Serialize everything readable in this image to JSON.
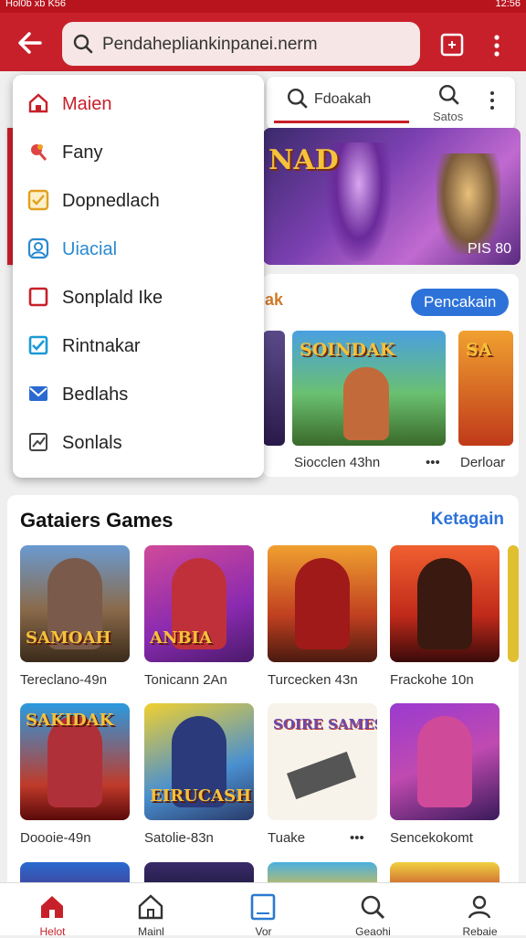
{
  "status_bar": {
    "left": "Hol0b xb K56",
    "right": "12:56"
  },
  "search": {
    "query": "Pendahepliankinpanei.nerm"
  },
  "menu": {
    "items": [
      {
        "label": "Maien",
        "icon": "home-icon",
        "color": "#c8202a"
      },
      {
        "label": "Fany",
        "icon": "paint-icon",
        "color": "#d44"
      },
      {
        "label": "Dopnedlach",
        "icon": "check-box-icon",
        "color": "#e0a020"
      },
      {
        "label": "Uiacial",
        "icon": "user-icon",
        "color": "#2a8ad0"
      },
      {
        "label": "Sonplald Ike",
        "icon": "square-icon",
        "color": "#c8202a"
      },
      {
        "label": "Rintnakar",
        "icon": "checkbox-icon",
        "color": "#1a9ad6"
      },
      {
        "label": "Bedlahs",
        "icon": "mail-icon",
        "color": "#2a6ad0"
      },
      {
        "label": "Sonlals",
        "icon": "chart-icon",
        "color": "#444"
      }
    ]
  },
  "search2": {
    "text": "Fdoakah",
    "label": "Satos"
  },
  "banner": {
    "logo": "NAD",
    "badge": "PIS 80"
  },
  "featured": {
    "title_fragment": "ak",
    "action": "Pencakain",
    "tiles": [
      {
        "title": "SOINDAK",
        "caption": "Siocclen 43hn"
      },
      {
        "title": "SA",
        "caption": "Derloar"
      }
    ]
  },
  "section": {
    "title": "Gataiers Games",
    "link": "Ketagain",
    "games": [
      {
        "title": "SAMOAH",
        "caption": "Tereclano-49n"
      },
      {
        "title": "ANBIA",
        "caption": "Tonicann 2An"
      },
      {
        "title": "",
        "caption": "Turcecken 43n"
      },
      {
        "title": "",
        "caption": "Frackohe 10n"
      },
      {
        "title": "SAKIDAK",
        "caption": "Doooie-49n"
      },
      {
        "title": "EIRUCASH",
        "caption": "Satolie-83n"
      },
      {
        "title": "SOIRE SAMES",
        "caption": "Tuake"
      },
      {
        "title": "",
        "caption": "Sencekokomt"
      }
    ]
  },
  "bottom_nav": [
    {
      "label": "Helot",
      "icon": "home-icon"
    },
    {
      "label": "Mainl",
      "icon": "house-icon"
    },
    {
      "label": "Vor",
      "icon": "tablet-icon"
    },
    {
      "label": "Geaohi",
      "icon": "search-icon"
    },
    {
      "label": "Rebaie",
      "icon": "user-icon"
    }
  ],
  "colors": {
    "brand": "#c8202a",
    "link": "#2d72d9"
  }
}
